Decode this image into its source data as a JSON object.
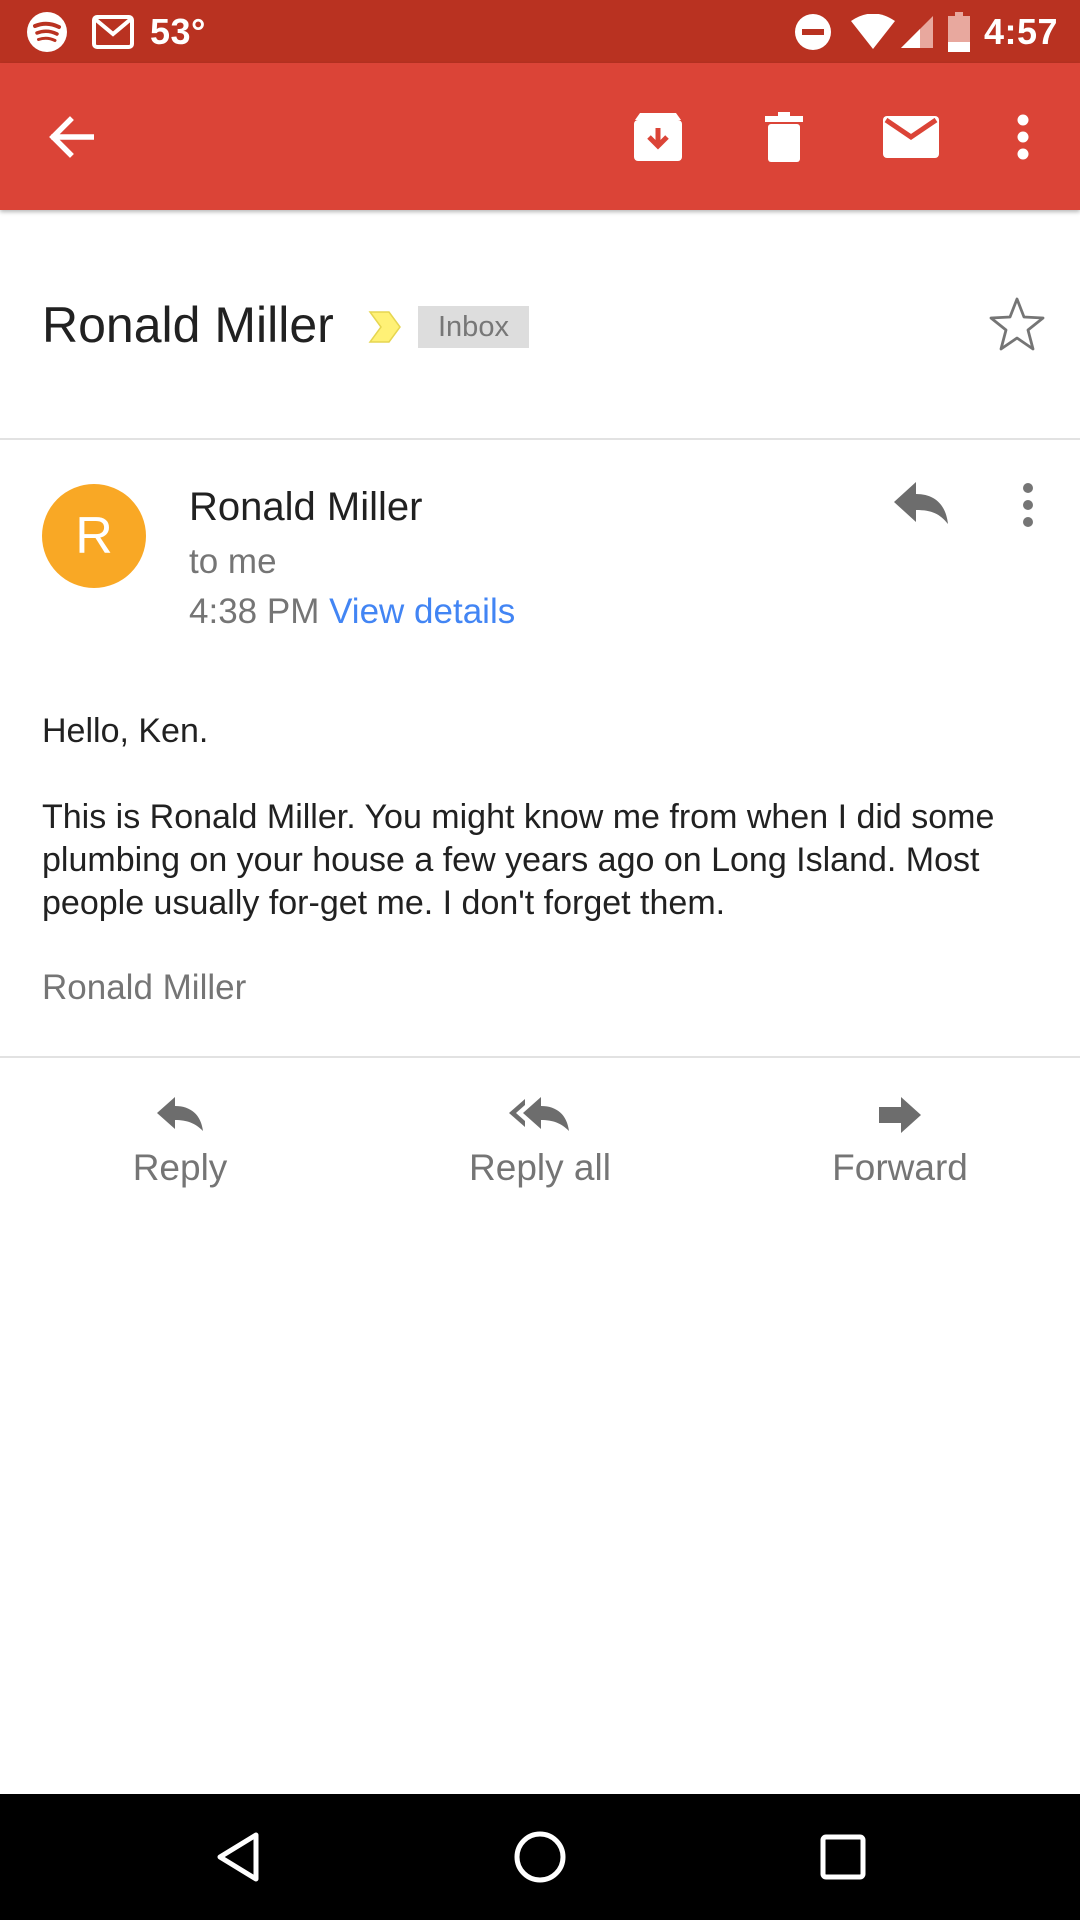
{
  "status_bar": {
    "temperature": "53°",
    "time": "4:57",
    "icons": [
      "spotify-icon",
      "gmail-icon",
      "do-not-disturb-icon",
      "wifi-icon",
      "signal-icon",
      "battery-icon"
    ]
  },
  "app_bar": {
    "icons": [
      "back-arrow-icon",
      "archive-icon",
      "delete-icon",
      "mark-unread-icon",
      "more-vert-icon"
    ],
    "color": "#db4437"
  },
  "email": {
    "subject": "Ronald Miller",
    "label": "Inbox",
    "sender_name": "Ronald Miller",
    "avatar_letter": "R",
    "avatar_color": "#f9a825",
    "recipient": "to me",
    "time": "4:38 PM",
    "view_details": "View details",
    "body": {
      "greeting": "Hello, Ken.",
      "paragraph": "This is Ronald Miller.  You might know me from when I did some plumbing on your house a few years ago on Long Island.  Most people usually for-get me.  I don't forget them."
    },
    "signature": "Ronald Miller"
  },
  "actions": {
    "reply": "Reply",
    "reply_all": "Reply all",
    "forward": "Forward"
  },
  "nav_bar": {
    "icons": [
      "back-triangle-icon",
      "home-circle-icon",
      "recents-square-icon"
    ]
  }
}
